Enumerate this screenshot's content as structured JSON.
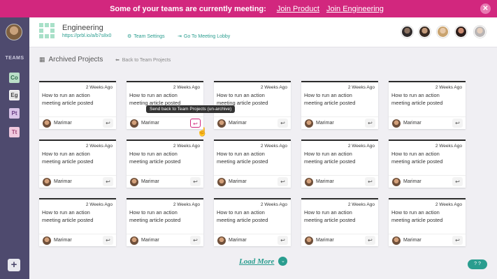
{
  "banner": {
    "message": "Some of your teams are currently meeting:",
    "links": [
      "Join Product",
      "Join Engineering"
    ],
    "close_icon": "✕"
  },
  "sidebar": {
    "teams_label": "TEAMS",
    "teams": [
      "Co",
      "Eg",
      "Pt",
      "Tt"
    ],
    "add_icon": "+"
  },
  "header": {
    "team_name": "Engineering",
    "team_link": "https://prbl.io/a/b7s8x0",
    "team_settings": "Team Settings",
    "meeting_lobby": "Go To Meeting Lobby",
    "settings_icon": "⚙",
    "lobby_icon": "⇥"
  },
  "archive": {
    "title": "Archived Projects",
    "back_label": "Back to Team Projects",
    "calendar_icon": "▦",
    "back_icon": "⬅"
  },
  "cards": [
    {
      "age": "2 Weeks Ago",
      "text": "How to run an action meeting article posted",
      "author": "Marimar"
    },
    {
      "age": "2 Weeks Ago",
      "text": "How to run an action meeting article posted",
      "author": "Marimar"
    },
    {
      "age": "2 Weeks Ago",
      "text": "How to run an action meeting article posted",
      "author": "Marimar"
    },
    {
      "age": "2 Weeks Ago",
      "text": "How to run an action meeting article posted",
      "author": "Marimar"
    },
    {
      "age": "2 Weeks Ago",
      "text": "How to run an action meeting article posted",
      "author": "Marimar"
    },
    {
      "age": "2 Weeks Ago",
      "text": "How to run an action meeting article posted",
      "author": "Marimar"
    },
    {
      "age": "2 Weeks Ago",
      "text": "How to run an action meeting article posted",
      "author": "Marimar"
    },
    {
      "age": "2 Weeks Ago",
      "text": "How to run an action meeting article posted",
      "author": "Marimar"
    },
    {
      "age": "2 Weeks Ago",
      "text": "How to run an action meeting article posted",
      "author": "Marimar"
    },
    {
      "age": "2 Weeks Ago",
      "text": "How to run an action meeting article posted",
      "author": "Marimar"
    },
    {
      "age": "2 Weeks Ago",
      "text": "How to run an action meeting article posted",
      "author": "Marimar"
    },
    {
      "age": "2 Weeks Ago",
      "text": "How to run an action meeting article posted",
      "author": "Marimar"
    },
    {
      "age": "2 Weeks Ago",
      "text": "How to run an action meeting article posted",
      "author": "Marimar"
    },
    {
      "age": "2 Weeks Ago",
      "text": "How to run an action meeting article posted",
      "author": "Marimar"
    },
    {
      "age": "2 Weeks Ago",
      "text": "How to run an action meeting article posted",
      "author": "Marimar"
    }
  ],
  "unarchive_icon": "↩",
  "tooltip": "Send back to Team Projects (un-archive)",
  "load_more": "Load More",
  "load_more_icon": "⌄",
  "colors": {
    "accent": "#d2277e",
    "teal": "#2a9d8f",
    "sidebar": "#4e4a6e"
  }
}
